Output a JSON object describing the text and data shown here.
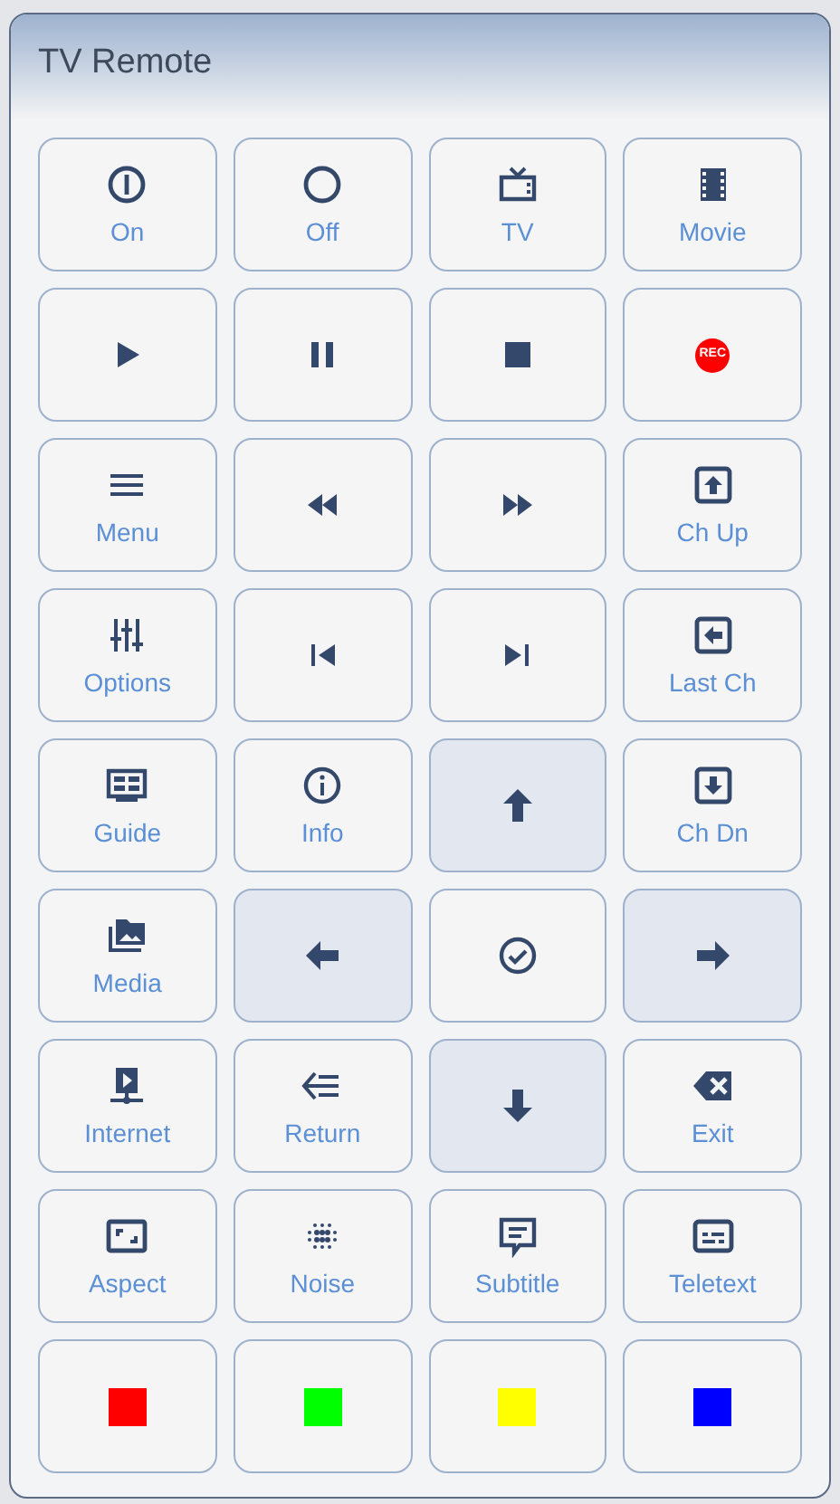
{
  "window": {
    "title": "TV Remote"
  },
  "buttons": [
    {
      "label": "On",
      "highlighted": false
    },
    {
      "label": "Off",
      "highlighted": false
    },
    {
      "label": "TV",
      "highlighted": false
    },
    {
      "label": "Movie",
      "highlighted": false
    },
    {
      "highlighted": false
    },
    {
      "highlighted": false
    },
    {
      "highlighted": false
    },
    {
      "badge": "REC",
      "highlighted": false
    },
    {
      "label": "Menu",
      "highlighted": false
    },
    {
      "highlighted": false
    },
    {
      "highlighted": false
    },
    {
      "label": "Ch Up",
      "highlighted": false
    },
    {
      "label": "Options",
      "highlighted": false
    },
    {
      "highlighted": false
    },
    {
      "highlighted": false
    },
    {
      "label": "Last Ch",
      "highlighted": false
    },
    {
      "label": "Guide",
      "highlighted": false
    },
    {
      "label": "Info",
      "highlighted": false
    },
    {
      "highlighted": true
    },
    {
      "label": "Ch Dn",
      "highlighted": false
    },
    {
      "label": "Media",
      "highlighted": false
    },
    {
      "highlighted": true
    },
    {
      "highlighted": false
    },
    {
      "highlighted": true
    },
    {
      "label": "Internet",
      "highlighted": false
    },
    {
      "label": "Return",
      "highlighted": false
    },
    {
      "highlighted": true
    },
    {
      "label": "Exit",
      "highlighted": false
    },
    {
      "label": "Aspect",
      "highlighted": false
    },
    {
      "label": "Noise",
      "highlighted": false
    },
    {
      "label": "Subtitle",
      "highlighted": false
    },
    {
      "label": "Teletext",
      "highlighted": false
    },
    {
      "color": "#ff0000",
      "highlighted": false
    },
    {
      "color": "#00ff00",
      "highlighted": false
    },
    {
      "color": "#ffff00",
      "highlighted": false
    },
    {
      "color": "#0000ff",
      "highlighted": false
    }
  ]
}
